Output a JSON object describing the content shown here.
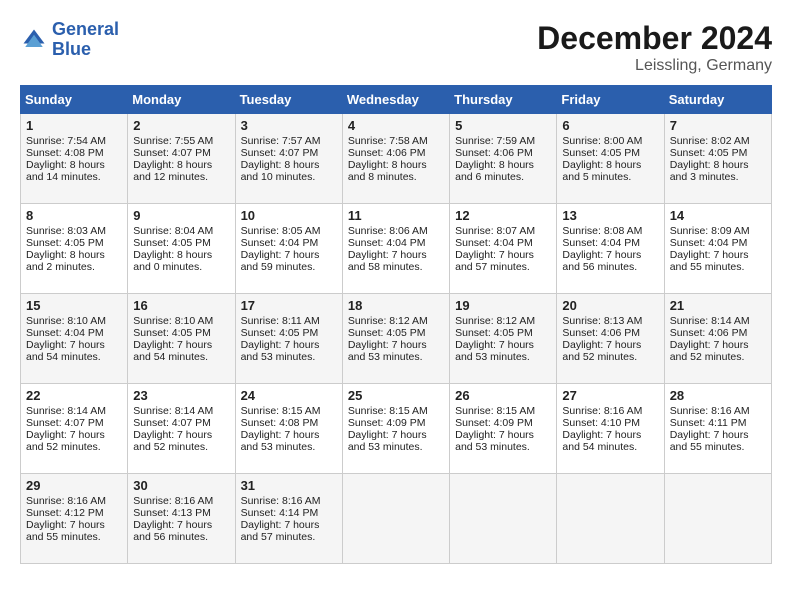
{
  "header": {
    "logo_line1": "General",
    "logo_line2": "Blue",
    "month": "December 2024",
    "location": "Leissling, Germany"
  },
  "weekdays": [
    "Sunday",
    "Monday",
    "Tuesday",
    "Wednesday",
    "Thursday",
    "Friday",
    "Saturday"
  ],
  "weeks": [
    [
      {
        "day": "1",
        "lines": [
          "Sunrise: 7:54 AM",
          "Sunset: 4:08 PM",
          "Daylight: 8 hours",
          "and 14 minutes."
        ]
      },
      {
        "day": "2",
        "lines": [
          "Sunrise: 7:55 AM",
          "Sunset: 4:07 PM",
          "Daylight: 8 hours",
          "and 12 minutes."
        ]
      },
      {
        "day": "3",
        "lines": [
          "Sunrise: 7:57 AM",
          "Sunset: 4:07 PM",
          "Daylight: 8 hours",
          "and 10 minutes."
        ]
      },
      {
        "day": "4",
        "lines": [
          "Sunrise: 7:58 AM",
          "Sunset: 4:06 PM",
          "Daylight: 8 hours",
          "and 8 minutes."
        ]
      },
      {
        "day": "5",
        "lines": [
          "Sunrise: 7:59 AM",
          "Sunset: 4:06 PM",
          "Daylight: 8 hours",
          "and 6 minutes."
        ]
      },
      {
        "day": "6",
        "lines": [
          "Sunrise: 8:00 AM",
          "Sunset: 4:05 PM",
          "Daylight: 8 hours",
          "and 5 minutes."
        ]
      },
      {
        "day": "7",
        "lines": [
          "Sunrise: 8:02 AM",
          "Sunset: 4:05 PM",
          "Daylight: 8 hours",
          "and 3 minutes."
        ]
      }
    ],
    [
      {
        "day": "8",
        "lines": [
          "Sunrise: 8:03 AM",
          "Sunset: 4:05 PM",
          "Daylight: 8 hours",
          "and 2 minutes."
        ]
      },
      {
        "day": "9",
        "lines": [
          "Sunrise: 8:04 AM",
          "Sunset: 4:05 PM",
          "Daylight: 8 hours",
          "and 0 minutes."
        ]
      },
      {
        "day": "10",
        "lines": [
          "Sunrise: 8:05 AM",
          "Sunset: 4:04 PM",
          "Daylight: 7 hours",
          "and 59 minutes."
        ]
      },
      {
        "day": "11",
        "lines": [
          "Sunrise: 8:06 AM",
          "Sunset: 4:04 PM",
          "Daylight: 7 hours",
          "and 58 minutes."
        ]
      },
      {
        "day": "12",
        "lines": [
          "Sunrise: 8:07 AM",
          "Sunset: 4:04 PM",
          "Daylight: 7 hours",
          "and 57 minutes."
        ]
      },
      {
        "day": "13",
        "lines": [
          "Sunrise: 8:08 AM",
          "Sunset: 4:04 PM",
          "Daylight: 7 hours",
          "and 56 minutes."
        ]
      },
      {
        "day": "14",
        "lines": [
          "Sunrise: 8:09 AM",
          "Sunset: 4:04 PM",
          "Daylight: 7 hours",
          "and 55 minutes."
        ]
      }
    ],
    [
      {
        "day": "15",
        "lines": [
          "Sunrise: 8:10 AM",
          "Sunset: 4:04 PM",
          "Daylight: 7 hours",
          "and 54 minutes."
        ]
      },
      {
        "day": "16",
        "lines": [
          "Sunrise: 8:10 AM",
          "Sunset: 4:05 PM",
          "Daylight: 7 hours",
          "and 54 minutes."
        ]
      },
      {
        "day": "17",
        "lines": [
          "Sunrise: 8:11 AM",
          "Sunset: 4:05 PM",
          "Daylight: 7 hours",
          "and 53 minutes."
        ]
      },
      {
        "day": "18",
        "lines": [
          "Sunrise: 8:12 AM",
          "Sunset: 4:05 PM",
          "Daylight: 7 hours",
          "and 53 minutes."
        ]
      },
      {
        "day": "19",
        "lines": [
          "Sunrise: 8:12 AM",
          "Sunset: 4:05 PM",
          "Daylight: 7 hours",
          "and 53 minutes."
        ]
      },
      {
        "day": "20",
        "lines": [
          "Sunrise: 8:13 AM",
          "Sunset: 4:06 PM",
          "Daylight: 7 hours",
          "and 52 minutes."
        ]
      },
      {
        "day": "21",
        "lines": [
          "Sunrise: 8:14 AM",
          "Sunset: 4:06 PM",
          "Daylight: 7 hours",
          "and 52 minutes."
        ]
      }
    ],
    [
      {
        "day": "22",
        "lines": [
          "Sunrise: 8:14 AM",
          "Sunset: 4:07 PM",
          "Daylight: 7 hours",
          "and 52 minutes."
        ]
      },
      {
        "day": "23",
        "lines": [
          "Sunrise: 8:14 AM",
          "Sunset: 4:07 PM",
          "Daylight: 7 hours",
          "and 52 minutes."
        ]
      },
      {
        "day": "24",
        "lines": [
          "Sunrise: 8:15 AM",
          "Sunset: 4:08 PM",
          "Daylight: 7 hours",
          "and 53 minutes."
        ]
      },
      {
        "day": "25",
        "lines": [
          "Sunrise: 8:15 AM",
          "Sunset: 4:09 PM",
          "Daylight: 7 hours",
          "and 53 minutes."
        ]
      },
      {
        "day": "26",
        "lines": [
          "Sunrise: 8:15 AM",
          "Sunset: 4:09 PM",
          "Daylight: 7 hours",
          "and 53 minutes."
        ]
      },
      {
        "day": "27",
        "lines": [
          "Sunrise: 8:16 AM",
          "Sunset: 4:10 PM",
          "Daylight: 7 hours",
          "and 54 minutes."
        ]
      },
      {
        "day": "28",
        "lines": [
          "Sunrise: 8:16 AM",
          "Sunset: 4:11 PM",
          "Daylight: 7 hours",
          "and 55 minutes."
        ]
      }
    ],
    [
      {
        "day": "29",
        "lines": [
          "Sunrise: 8:16 AM",
          "Sunset: 4:12 PM",
          "Daylight: 7 hours",
          "and 55 minutes."
        ]
      },
      {
        "day": "30",
        "lines": [
          "Sunrise: 8:16 AM",
          "Sunset: 4:13 PM",
          "Daylight: 7 hours",
          "and 56 minutes."
        ]
      },
      {
        "day": "31",
        "lines": [
          "Sunrise: 8:16 AM",
          "Sunset: 4:14 PM",
          "Daylight: 7 hours",
          "and 57 minutes."
        ]
      },
      null,
      null,
      null,
      null
    ]
  ]
}
